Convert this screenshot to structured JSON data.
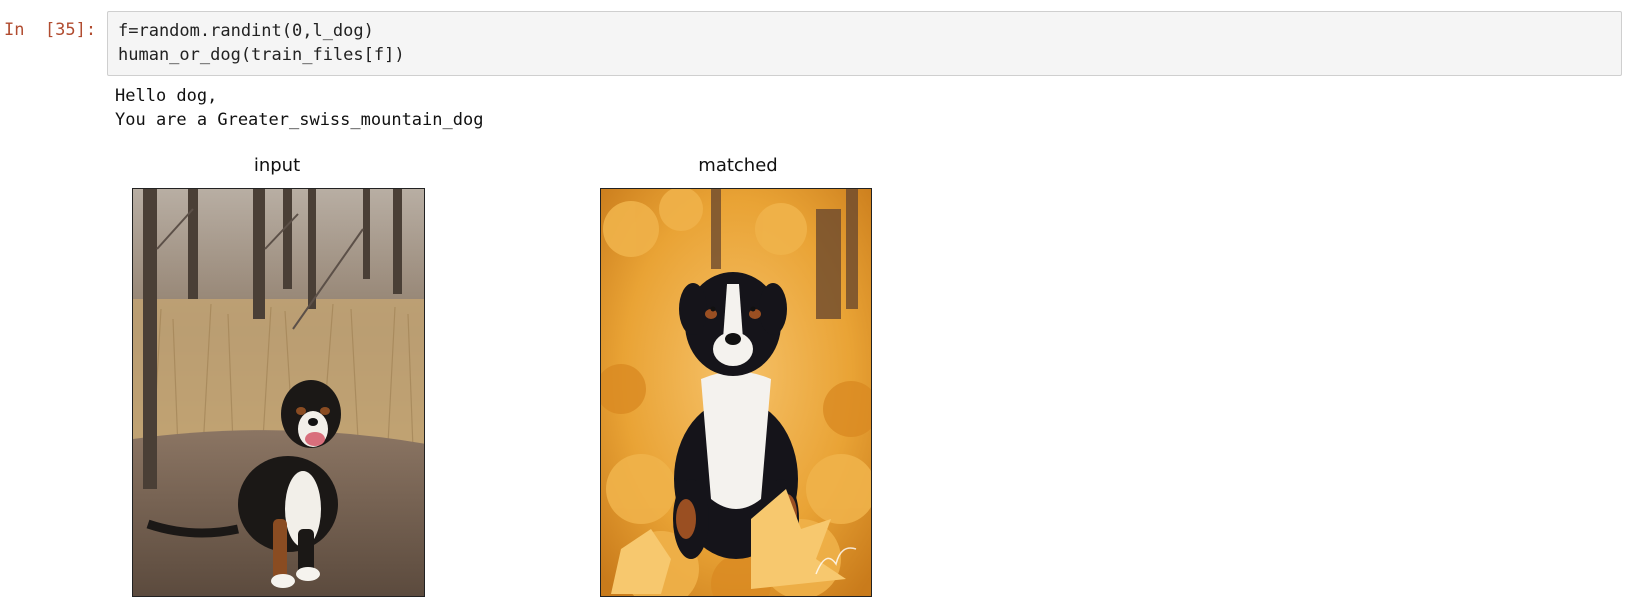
{
  "cell": {
    "prompt": "In  [35]:",
    "code_lines": [
      "f=random.randint(0,l_dog)",
      "human_or_dog(train_files[f])"
    ],
    "output_lines": [
      "Hello dog,",
      "You are a Greater_swiss_mountain_dog"
    ],
    "figures": [
      {
        "title": "input",
        "image": "dog-photo-woodland-trail"
      },
      {
        "title": "matched",
        "image": "dog-photo-autumn-leaves"
      }
    ]
  }
}
